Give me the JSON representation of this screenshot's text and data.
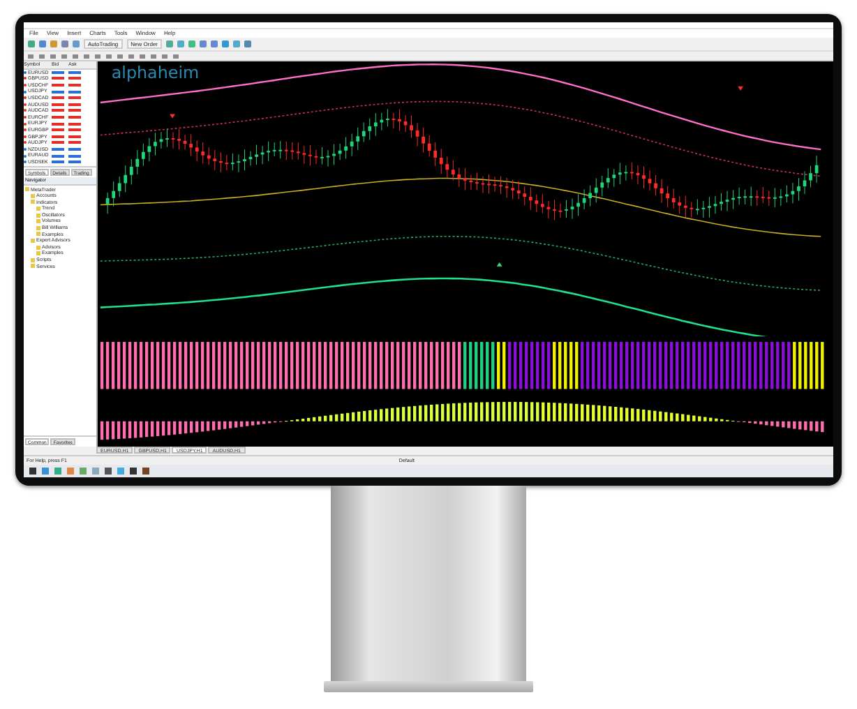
{
  "menu": [
    "File",
    "View",
    "Insert",
    "Charts",
    "Tools",
    "Window",
    "Help"
  ],
  "toolbar": {
    "buttons": [
      "AutoTrading",
      "New Order"
    ]
  },
  "logo": {
    "text": "alphaheim"
  },
  "market_watch": {
    "columns": [
      "Symbol",
      "Bid",
      "Ask"
    ],
    "rows": [
      {
        "symbol": "EURUSD",
        "rising": true
      },
      {
        "symbol": "GBPUSD",
        "rising": false
      },
      {
        "symbol": "USDCHF",
        "rising": false
      },
      {
        "symbol": "USDJPY",
        "rising": true
      },
      {
        "symbol": "USDCAD",
        "rising": false
      },
      {
        "symbol": "AUDUSD",
        "rising": false
      },
      {
        "symbol": "AUDCAD",
        "rising": false
      },
      {
        "symbol": "EURCHF",
        "rising": false
      },
      {
        "symbol": "EURJPY",
        "rising": false
      },
      {
        "symbol": "EURGBP",
        "rising": false
      },
      {
        "symbol": "GBPJPY",
        "rising": false
      },
      {
        "symbol": "AUDJPY",
        "rising": false
      },
      {
        "symbol": "NZDUSD",
        "rising": true
      },
      {
        "symbol": "EURAUD",
        "rising": true
      },
      {
        "symbol": "USDSEK",
        "rising": true
      }
    ],
    "tabs": [
      {
        "label": "Symbols",
        "selected": true
      },
      {
        "label": "Details",
        "selected": false
      },
      {
        "label": "Trading",
        "selected": false
      }
    ]
  },
  "navigator": {
    "title": "Navigator",
    "items": [
      {
        "label": "MetaTrader",
        "children": [
          {
            "label": "Accounts"
          },
          {
            "label": "Indicators",
            "children": [
              {
                "label": "Trend"
              },
              {
                "label": "Oscillators"
              },
              {
                "label": "Volumes"
              },
              {
                "label": "Bill Williams"
              },
              {
                "label": "Examples"
              }
            ]
          },
          {
            "label": "Expert Advisors",
            "children": [
              {
                "label": "Advisors"
              },
              {
                "label": "Examples"
              }
            ]
          },
          {
            "label": "Scripts"
          },
          {
            "label": "Services"
          }
        ]
      }
    ],
    "tabs": [
      {
        "label": "Common",
        "selected": true
      },
      {
        "label": "Favorites",
        "selected": false
      }
    ]
  },
  "chart_tabs": [
    {
      "label": "EURUSD,H1",
      "selected": false
    },
    {
      "label": "GBPUSD,H1",
      "selected": false
    },
    {
      "label": "USDJPY,H1",
      "selected": true
    },
    {
      "label": "AUDUSD,H1",
      "selected": false
    }
  ],
  "status_bar": {
    "help": "For Help, press F1",
    "profile": "Default"
  }
}
